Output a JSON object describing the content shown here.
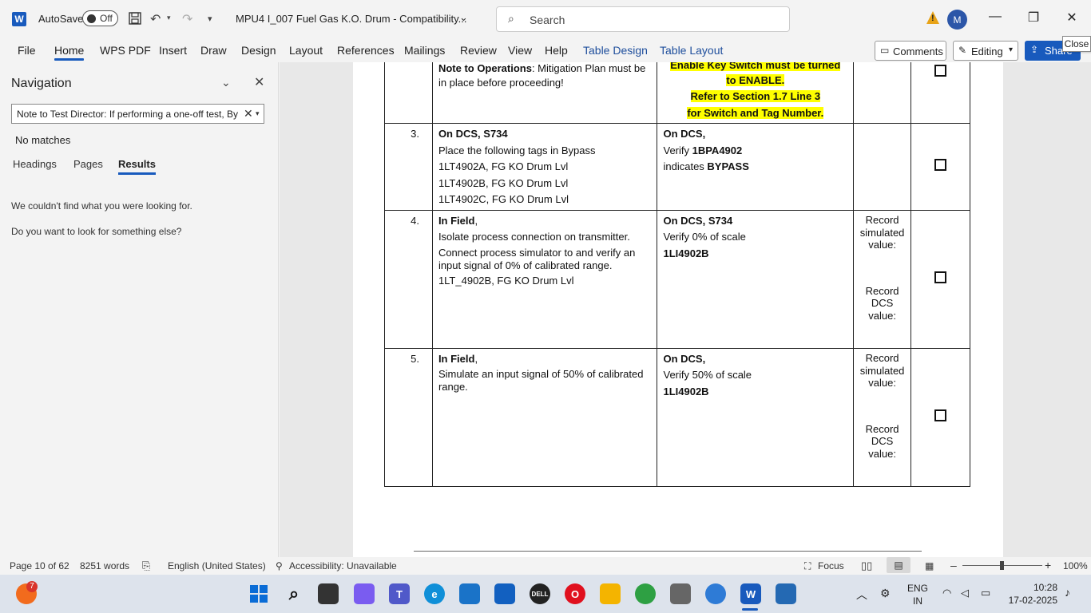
{
  "titlebar": {
    "app_logo": "W",
    "autosave_label": "AutoSave",
    "autosave_state": "Off",
    "doc_title": "MPU4 I_007 Fuel Gas K.O. Drum  -  Compatibility...",
    "search_placeholder": "Search",
    "avatar_initial": "M"
  },
  "ribbon": {
    "tabs": [
      "File",
      "Home",
      "WPS PDF",
      "Insert",
      "Draw",
      "Design",
      "Layout",
      "References",
      "Mailings",
      "Review",
      "View",
      "Help",
      "Table Design",
      "Table Layout"
    ],
    "active_tab": "Home",
    "comments_label": "Comments",
    "editing_label": "Editing",
    "share_label": "Share",
    "tooltip": "Close"
  },
  "navigation": {
    "title": "Navigation",
    "search_value": "Note to Test Director: If performing a one-off test, By",
    "status": "No matches",
    "tabs": [
      "Headings",
      "Pages",
      "Results"
    ],
    "active_tab": "Results",
    "message1": "We couldn't find what you were looking for.",
    "message2": "Do you want to look for something else?"
  },
  "table": {
    "row_top": {
      "step_bold": "Note to Operations",
      "step_rest": ": Mitigation Plan must be in place before proceeding!",
      "verify_hl1": "Enable Key Switch must be turned",
      "verify_hl2": "to ENABLE.",
      "verify_hl3": "Refer to Section 1.7 Line 3",
      "verify_hl4": "for Switch and Tag Number."
    },
    "row3": {
      "num": "3.",
      "step_head": "On DCS, S734",
      "step_lines": [
        "Place the following tags in Bypass",
        "1LT4902A, FG KO Drum Lvl",
        "1LT4902B, FG KO Drum Lvl",
        "1LT4902C, FG KO Drum Lvl"
      ],
      "verify_head": "On DCS,",
      "verify_pre": "Verify ",
      "verify_tag": "1BPA4902",
      "verify_ind_pre": " indicates ",
      "verify_ind": "BYPASS"
    },
    "row4": {
      "num": "4.",
      "step_head": "In Field",
      "step_head_suffix": ",",
      "step_lines": [
        "Isolate process connection on transmitter.",
        "Connect process simulator to and verify an input signal of 0% of calibrated range.",
        "1LT_4902B, FG KO Drum Lvl"
      ],
      "verify_head": "On DCS, S734",
      "verify_line": "Verify 0% of scale",
      "verify_tag": "1LI4902B",
      "record1": "Record simulated value:",
      "record2": "Record DCS value:"
    },
    "row5": {
      "num": "5.",
      "step_head": "In Field",
      "step_head_suffix": ",",
      "step_lines": [
        "Simulate an input signal of 50% of calibrated range."
      ],
      "verify_head": "On DCS,",
      "verify_line": "Verify 50% of scale",
      "verify_tag": "1LI4902B",
      "record1": "Record simulated value:",
      "record2": "Record DCS value:"
    }
  },
  "statusbar": {
    "page": "Page 10 of 62",
    "words": "8251 words",
    "language": "English (United States)",
    "accessibility": "Accessibility: Unavailable",
    "focus": "Focus",
    "zoom": "100%"
  },
  "taskbar": {
    "notification_count": "7",
    "lang": "ENG",
    "region": "IN",
    "time": "10:28",
    "date": "17-02-2025"
  },
  "colors": {
    "word_blue": "#185abd",
    "highlight": "#ffff00",
    "warning": "#e8a317"
  }
}
